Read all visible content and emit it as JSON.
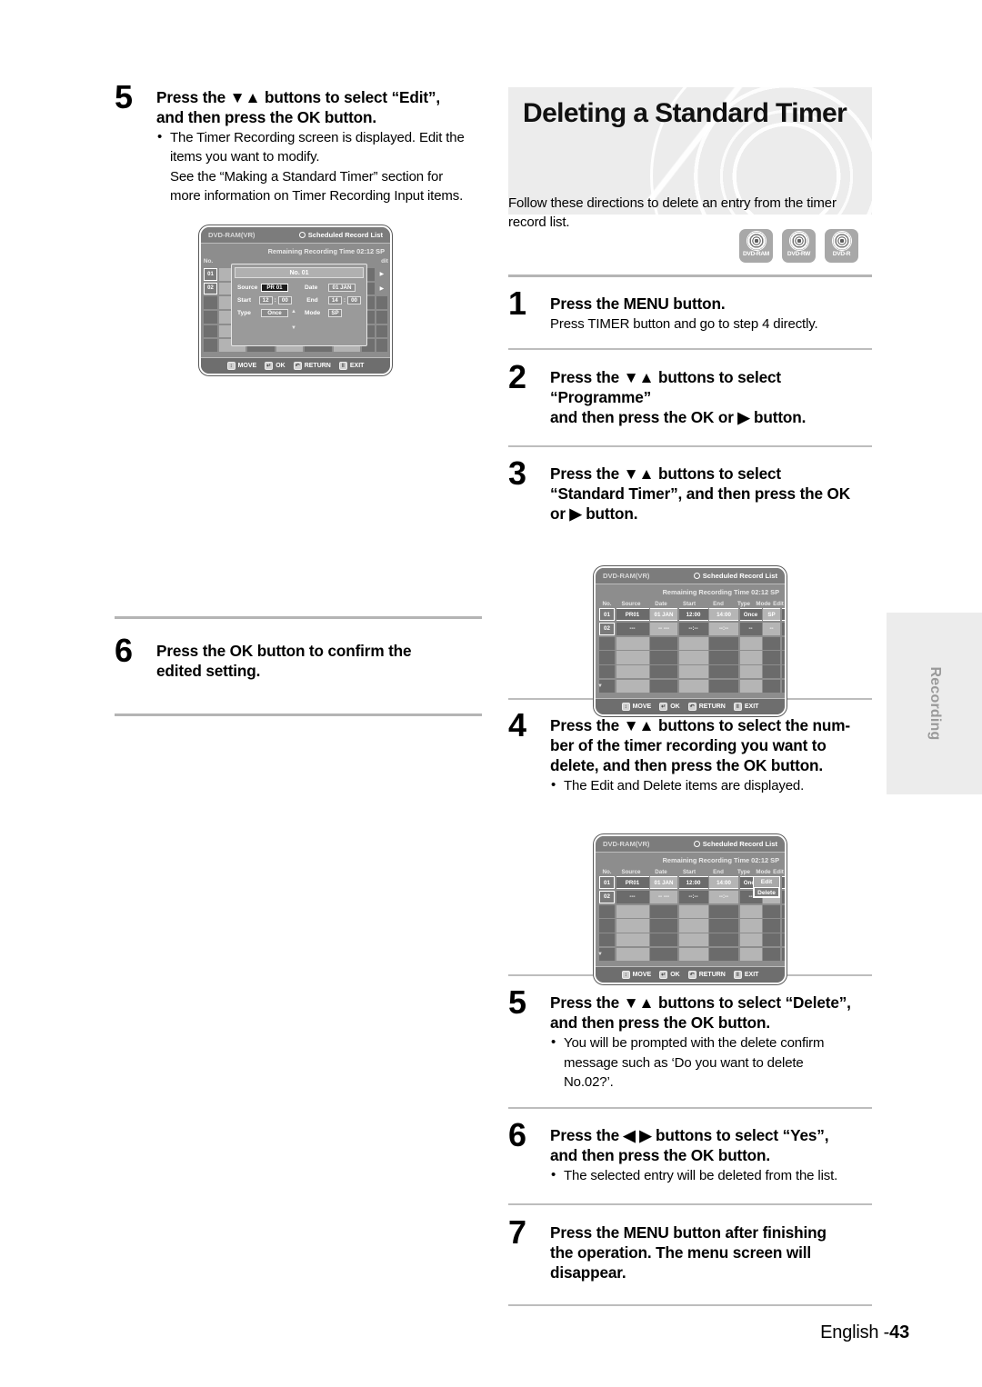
{
  "page": {
    "footer_text": "English -",
    "footer_page": "43",
    "side_tab": "Recording"
  },
  "banner": {
    "title": "Deleting a Standard Timer"
  },
  "disc_logos": [
    {
      "label": "DVD-RAM",
      "name": "dvd-ram-logo"
    },
    {
      "label": "DVD-RW",
      "name": "dvd-rw-logo"
    },
    {
      "label": "DVD-R",
      "name": "dvd-r-logo"
    }
  ],
  "intro": "Follow these directions to delete an entry from the timer record list.",
  "left_steps": [
    {
      "num": "5",
      "head_line1": "Press the ▼▲ buttons to select “Edit”,",
      "head_line2": "and then press the OK button.",
      "bullet1_line1": "The Timer Recording screen is displayed.  Edit the",
      "bullet1_line2": "items you want to modify.",
      "sub_line1": "See the “Making a Standard Timer” section for",
      "sub_line2": "more information on Timer Recording Input items."
    },
    {
      "num": "6",
      "head_line1": "Press the OK button to confirm the",
      "head_line2": "edited setting."
    }
  ],
  "right_steps": [
    {
      "num": "1",
      "head_line1": "Press the MENU button.",
      "sub_line1": "Press TIMER button and go to step 4 directly."
    },
    {
      "num": "2",
      "head_line1": "Press the ▼▲ buttons to select “Programme”",
      "head_line2": "and then press the OK or ▶ button."
    },
    {
      "num": "3",
      "head_line1": "Press the ▼▲ buttons to select",
      "head_line2": "“Standard Timer”, and then press the OK",
      "head_line3": "or ▶ button."
    },
    {
      "num": "4",
      "head_line1": "Press the ▼▲ buttons to select the num-",
      "head_line2": "ber of the timer recording you want to",
      "head_line3": "delete, and then press the OK button.",
      "bullet1_line1": "The Edit and Delete items are displayed."
    },
    {
      "num": "5",
      "head_line1": "Press the ▼▲ buttons to select “Delete”,",
      "head_line2": "and then press the OK button.",
      "bullet1_line1": "You will be prompted with the delete confirm",
      "bullet1_line2": "message such as ‘Do you want to delete",
      "bullet1_line3": "No.02?’."
    },
    {
      "num": "6",
      "head_line1": "Press the ◀ ▶ buttons to select “Yes”,",
      "head_line2": "and then press the OK button.",
      "bullet1_line1": "The selected entry will be deleted from the list."
    },
    {
      "num": "7",
      "head_line1": "Press the MENU button after finishing",
      "head_line2": "the operation. The menu screen will",
      "head_line3": "disappear."
    }
  ],
  "osd_common": {
    "disc_type": "DVD-RAM(VR)",
    "screen_title": "Scheduled Record List",
    "remaining": "Remaining Recording Time 02:12 SP",
    "bottom_bar": [
      {
        "key": "↕",
        "label": "MOVE"
      },
      {
        "key": "↵",
        "label": "OK"
      },
      {
        "key": "↶",
        "label": "RETURN"
      },
      {
        "key": "‖",
        "label": "EXIT"
      }
    ],
    "columns": [
      "No.",
      "Source",
      "Date",
      "Start",
      "End",
      "Type",
      "Mode",
      "Edit"
    ]
  },
  "osd_timer_dialog": {
    "title": "No. 01",
    "fields": [
      {
        "label": "Source",
        "value": "PR 01",
        "selected": true
      },
      {
        "label": "Date",
        "value": "01 JAN",
        "selected": false
      },
      {
        "label": "Start",
        "value_h": "12",
        "value_m": "00",
        "selected": false
      },
      {
        "label": "End",
        "value_h": "14",
        "value_m": "00",
        "selected": false
      },
      {
        "label": "Type",
        "value": "Once",
        "selected": false
      },
      {
        "label": "Mode",
        "value": "SP",
        "selected": false
      }
    ],
    "row_numbers": [
      "01",
      "02"
    ],
    "up_arrow": "▲",
    "down_arrow": "▼"
  },
  "osd_list": {
    "rows": [
      {
        "no": "01",
        "source": "PR01",
        "date": "01 JAN",
        "start": "12:00",
        "end": "14:00",
        "type": "Once",
        "mode": "SP",
        "edit": "▶"
      },
      {
        "no": "02",
        "source": "---",
        "date": "-- ---",
        "start": "--:--",
        "end": "--:--",
        "type": "--",
        "mode": "--",
        "edit": "▶"
      }
    ],
    "scroll_indicator": "▼"
  },
  "osd_list_popup": {
    "items": [
      {
        "label": "Edit",
        "highlighted": false
      },
      {
        "label": "Delete",
        "highlighted": true
      }
    ]
  }
}
